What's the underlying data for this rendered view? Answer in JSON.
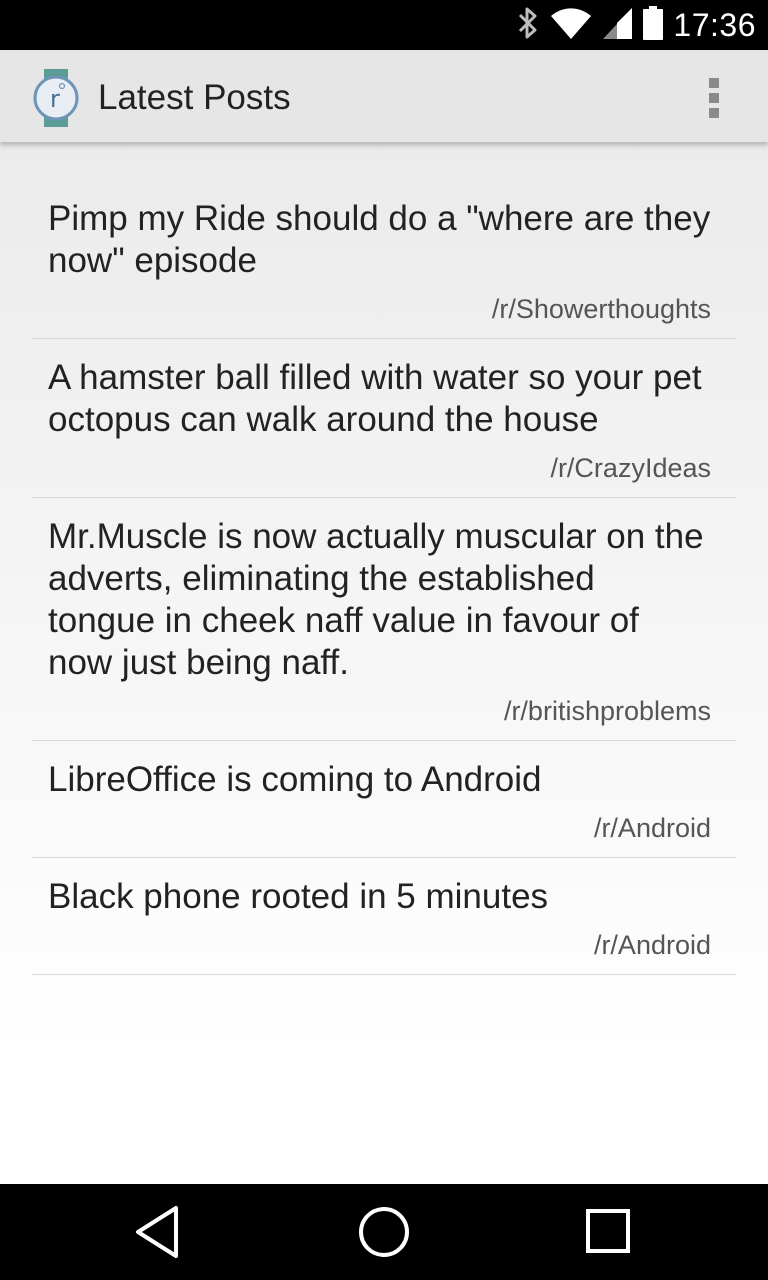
{
  "status_bar": {
    "time": "17:36",
    "icons": [
      "bluetooth-icon",
      "wifi-icon",
      "signal-icon",
      "battery-icon"
    ]
  },
  "action_bar": {
    "title": "Latest Posts",
    "logo_letter": "r",
    "logo_icon": "reddit-logo-icon",
    "overflow_icon": "overflow-menu-icon"
  },
  "posts": [
    {
      "title": "Pimp my Ride should do a \"where are they now\" episode",
      "subreddit": "/r/Showerthoughts"
    },
    {
      "title": "A hamster ball filled with water so your pet octopus can walk around the house",
      "subreddit": "/r/CrazyIdeas"
    },
    {
      "title": "Mr.Muscle is now actually muscular on the adverts, eliminating the established tongue in cheek naff value in favour of now just being naff.",
      "subreddit": "/r/britishproblems"
    },
    {
      "title": "LibreOffice is coming to Android",
      "subreddit": "/r/Android"
    },
    {
      "title": "Black phone rooted in 5 minutes",
      "subreddit": "/r/Android"
    }
  ],
  "nav_bar": {
    "icons": [
      "back-icon",
      "home-icon",
      "recents-icon"
    ]
  },
  "colors": {
    "action_bar_bg": "#e6e6e6",
    "logo_ring": "#6e95b5",
    "logo_band": "#5b9c97",
    "title_text": "#222222",
    "subreddit_text": "#555555",
    "divider": "#d8d8d8"
  }
}
